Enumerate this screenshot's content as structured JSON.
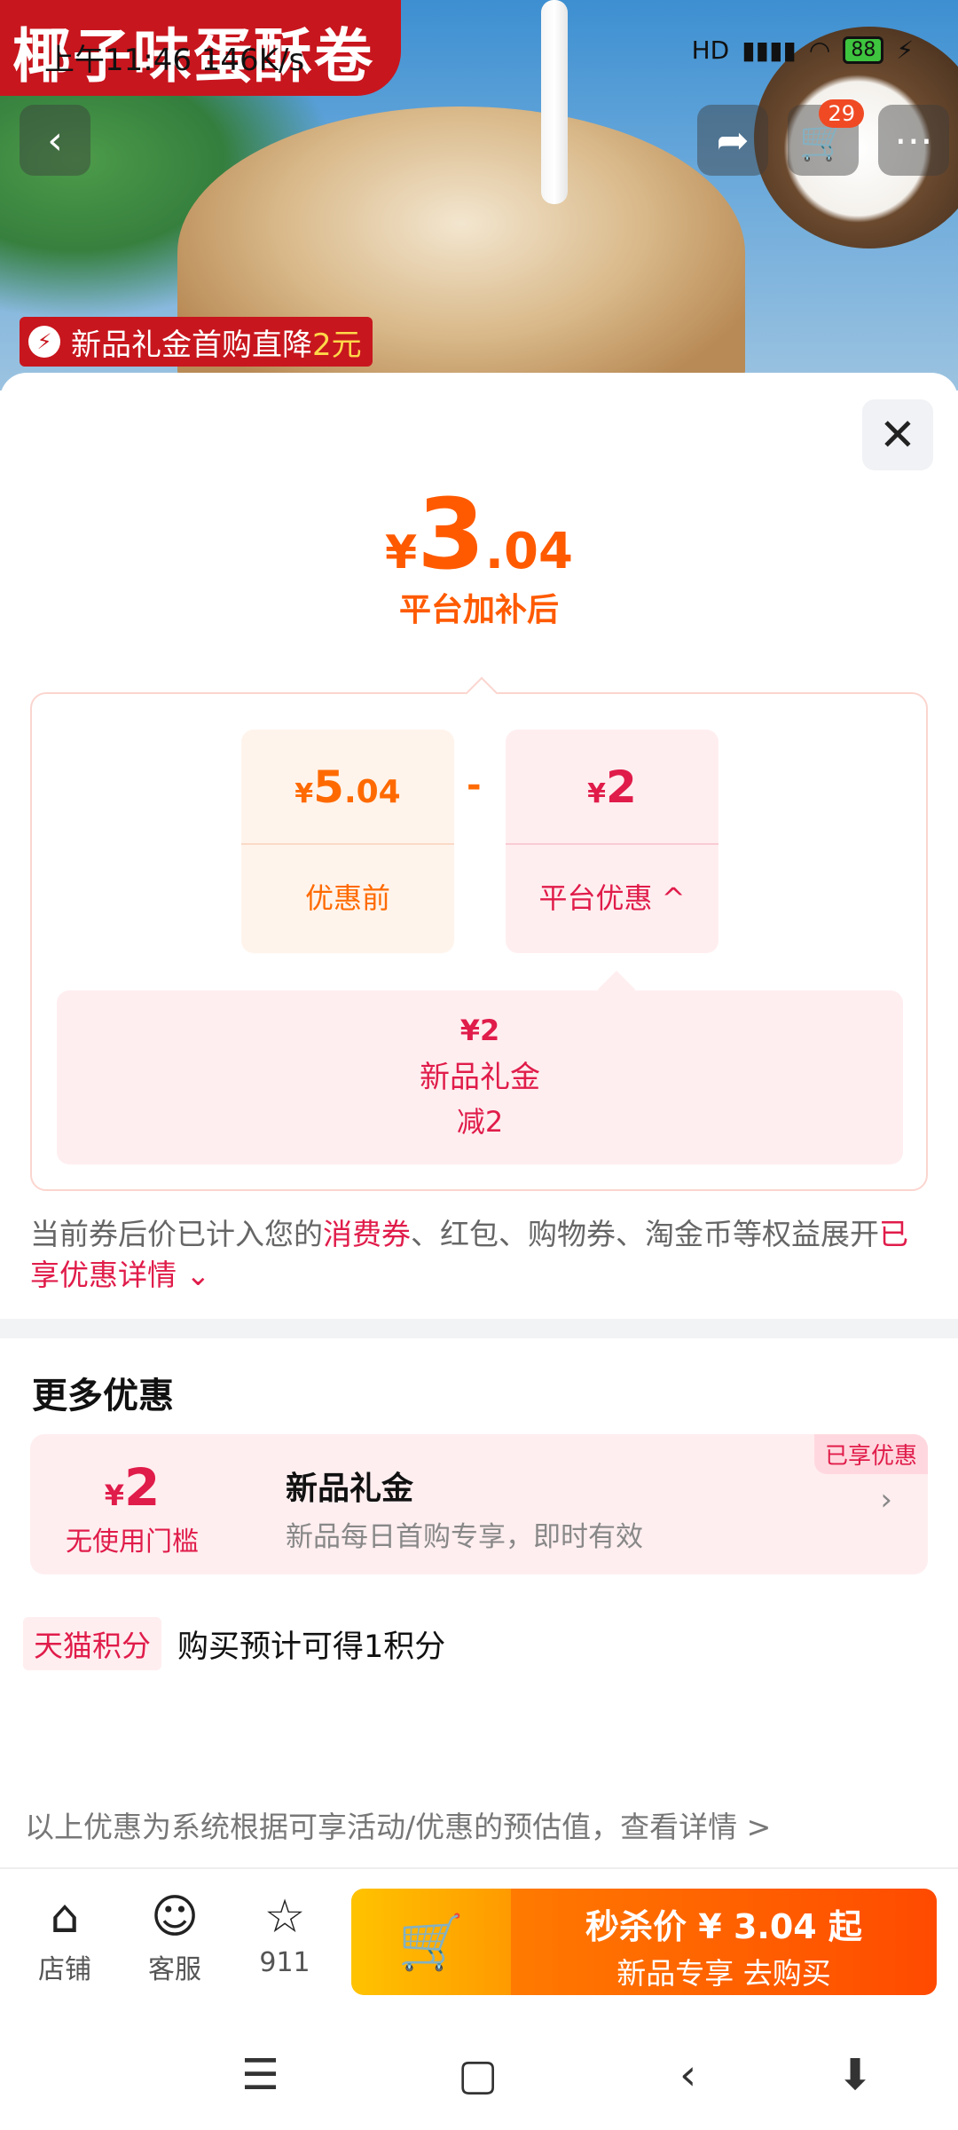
{
  "status": {
    "time": "上午11:46",
    "speed": "146K/s",
    "net": "HD",
    "battery": "88"
  },
  "hero": {
    "title": "椰子味蛋酥卷",
    "promo_prefix": "新品礼金首购直降",
    "promo_amount": "2元",
    "cart_count": "29"
  },
  "sheet": {
    "final_currency": "¥",
    "final_int": "3",
    "final_dec": ".04",
    "final_label": "平台加补后",
    "before": {
      "currency": "¥",
      "int": "5",
      "dec": ".04",
      "label": "优惠前"
    },
    "minus": "-",
    "discount": {
      "currency": "¥",
      "int": "2",
      "label": "平台优惠"
    },
    "detail": {
      "amount": "¥2",
      "name": "新品礼金",
      "reduce": "减2"
    },
    "note_a": "当前券后价已计入您的",
    "note_hl1": "消费券",
    "note_b": "、红包、购物券、淘金币等权益展开",
    "note_hl2": "已享优惠详情",
    "more_title": "更多优惠",
    "coupon": {
      "currency": "¥",
      "amount": "2",
      "condition": "无使用门槛",
      "title": "新品礼金",
      "desc": "新品每日首购专享，即时有效",
      "tag": "已享优惠"
    },
    "points_tag": "天猫积分",
    "points_text": "购买预计可得1积分",
    "disclaimer": "以上优惠为系统根据可享活动/优惠的预估值，查看详情 >"
  },
  "bar": {
    "shop": "店铺",
    "service": "客服",
    "fav_count": "911",
    "buy_line1": "秒杀价 ¥ 3.04 起",
    "buy_line2": "新品专享  去购买"
  },
  "colors": {
    "accent": "#ff5a00",
    "red": "#e01c4a",
    "brand": "#c8161e"
  }
}
